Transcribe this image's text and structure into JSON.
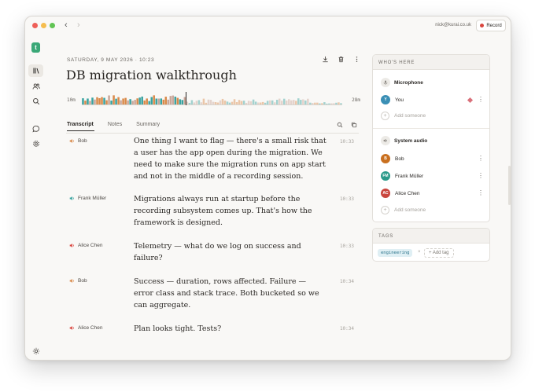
{
  "titlebar": {
    "account": "nick@kurai.co.uk",
    "record_label": "Record",
    "back": "‹",
    "forward": "›"
  },
  "sidebar": {
    "logo": "t",
    "items": [
      {
        "icon": "library-icon",
        "active": true
      },
      {
        "icon": "people-icon",
        "active": false
      },
      {
        "icon": "search-icon",
        "active": false
      },
      {
        "icon": "chat-icon",
        "active": false
      },
      {
        "icon": "settings-icon",
        "active": false
      }
    ],
    "bottom_icon": "sun-icon"
  },
  "note": {
    "date": "SATURDAY, 9 MAY 2026 · 10:23",
    "title": "DB migration walkthrough",
    "actions": [
      "download-icon",
      "trash-icon",
      "more-icon"
    ]
  },
  "waveform": {
    "start_label": "10m",
    "end_label": "28m",
    "played_fraction": 0.4,
    "colors": [
      "#d98a4a",
      "#3aa3a0",
      "#c9a79a"
    ]
  },
  "tabs": [
    {
      "label": "Transcript",
      "active": true
    },
    {
      "label": "Notes",
      "active": false
    },
    {
      "label": "Summary",
      "active": false
    }
  ],
  "transcript": [
    {
      "speaker": "Bob",
      "color": "#d98a4a",
      "text": "One thing I want to flag — there's a small risk that a user has the app open during the migration. We need to make sure the migration runs on app start and not in the middle of a recording session.",
      "time": "10:33"
    },
    {
      "speaker": "Frank Müller",
      "color": "#3aa3a0",
      "text": "Migrations always run at startup before the recording subsystem comes up. That's how the framework is designed.",
      "time": "10:33"
    },
    {
      "speaker": "Alice Chen",
      "color": "#d9463f",
      "text": "Telemetry — what do we log on success and failure?",
      "time": "10:33"
    },
    {
      "speaker": "Bob",
      "color": "#d98a4a",
      "text": "Success — duration, rows affected. Failure — error class and stack trace. Both bucketed so we can aggregate.",
      "time": "10:34"
    },
    {
      "speaker": "Alice Chen",
      "color": "#d9463f",
      "text": "Plan looks tight. Tests?",
      "time": "10:34"
    }
  ],
  "whos_here": {
    "header": "WHO'S HERE",
    "microphone": {
      "title": "Microphone",
      "people": [
        {
          "initials": "Y",
          "name": "You",
          "color": "#3a8fb5",
          "recording": true
        }
      ],
      "add_label": "Add someone"
    },
    "system_audio": {
      "title": "System audio",
      "people": [
        {
          "initials": "B",
          "name": "Bob",
          "color": "#c9701f"
        },
        {
          "initials": "FM",
          "name": "Frank Müller",
          "color": "#2a9a8a"
        },
        {
          "initials": "AC",
          "name": "Alice Chen",
          "color": "#c9453d"
        }
      ],
      "add_label": "Add someone"
    }
  },
  "tags": {
    "header": "TAGS",
    "items": [
      "engineering"
    ],
    "remove": "×",
    "add_label": "+ Add tag"
  }
}
